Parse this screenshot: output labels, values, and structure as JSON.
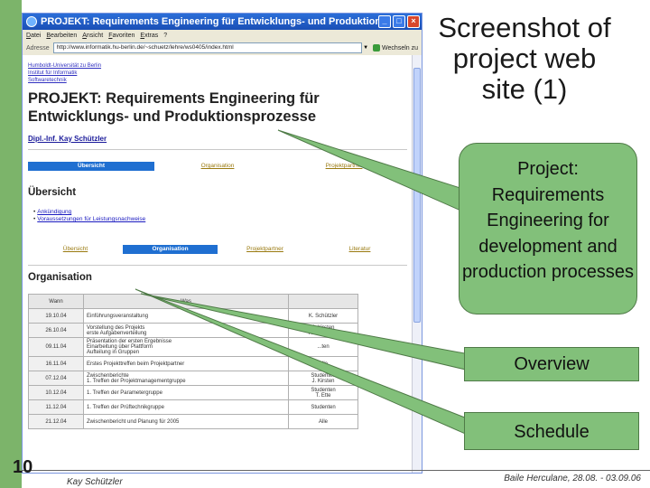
{
  "slide": {
    "title": "Screenshot of project web site (1)",
    "number": "10",
    "footer_left": "Kay Schützler",
    "footer_right": "Baile Herculane, 28.08. - 03.09.06"
  },
  "browser": {
    "window_title": "PROJEKT: Requirements Engineering für Entwicklungs- und Produktionsprozesse ...",
    "menu": [
      "Datei",
      "Bearbeiten",
      "Ansicht",
      "Favoriten",
      "Extras",
      "?"
    ],
    "address_label": "Adresse",
    "address_value": "http://www.informatik.hu-berlin.de/~schuetz/lehre/ws0405/index.html",
    "go_label": "Wechseln zu",
    "university_links": [
      "Humboldt-Universität zu Berlin",
      "Institut für Informatik",
      "Softwaretechnik"
    ],
    "page_title_line1": "PROJEKT: Requirements Engineering für",
    "page_title_line2": "Entwicklungs- und Produktionsprozesse",
    "author": "Dipl.-Inf. Kay Schützler",
    "nav1": [
      "Übersicht",
      "Organisation",
      "Projektpartner"
    ],
    "overview_heading": "Übersicht",
    "overview_items": [
      "Ankündigung",
      "Voraussetzungen für Leistungsnachweise"
    ],
    "nav2": [
      "Übersicht",
      "Organisation",
      "Projektpartner",
      "Literatur"
    ],
    "org_heading": "Organisation",
    "schedule_headers": [
      "Wann",
      "Was",
      ""
    ],
    "schedule_rows": [
      {
        "date": "19.10.04",
        "what": "Einführungsveranstaltung",
        "who": "K. Schützler"
      },
      {
        "date": "26.10.04",
        "what": "Vorstellung des Projekts\nerste Aufgabenverteilung",
        "who": "J. Kirsten\nK. Schützler"
      },
      {
        "date": "09.11.04",
        "what": "Präsentation der ersten Ergebnisse\nEinarbeitung über Plattform\nAufteilung in Gruppen",
        "who": "...ten"
      },
      {
        "date": "16.11.04",
        "what": "Erstes Projekttreffen beim Projektpartner",
        "who": "Alle"
      },
      {
        "date": "07.12.04",
        "what": "Zwischenberichte\n1. Treffen der Projektmanagementgruppe",
        "who": "Studenten\nJ. Kirsten"
      },
      {
        "date": "10.12.04",
        "what": "1. Treffen der Parametergruppe",
        "who": "Studenten\nT. Ette"
      },
      {
        "date": "11.12.04",
        "what": "1. Treffen der Prüftechnikgruppe",
        "who": "Studenten"
      },
      {
        "date": "21.12.04",
        "what": "Zwischenbericht und Planung für 2005",
        "who": "Alle"
      }
    ]
  },
  "callouts": {
    "project": "Project: Requirements Engineering for development and production processes",
    "overview": "Overview",
    "schedule": "Schedule"
  },
  "colors": {
    "accent_green": "#82c07a",
    "bar_green": "#7cb46a",
    "nav_active": "#1f6fd1"
  }
}
